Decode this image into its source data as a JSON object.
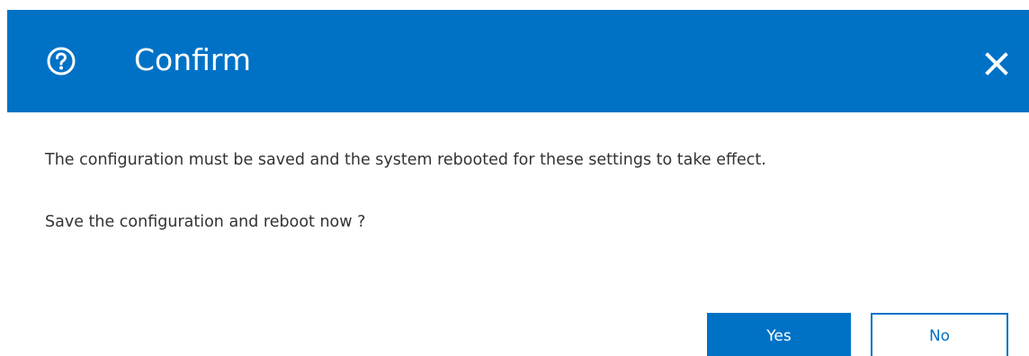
{
  "dialog": {
    "title": "Confirm",
    "title_icon": "question-circle-icon",
    "close_icon": "close-icon",
    "messages": [
      "The configuration must be saved and the system rebooted for these settings to take effect.",
      "Save the configuration and reboot now ?"
    ],
    "buttons": {
      "yes_label": "Yes",
      "no_label": "No"
    }
  },
  "colors": {
    "accent": "#0072c6",
    "header_text": "#ffffff",
    "body_text": "#333333",
    "background": "#ffffff"
  }
}
